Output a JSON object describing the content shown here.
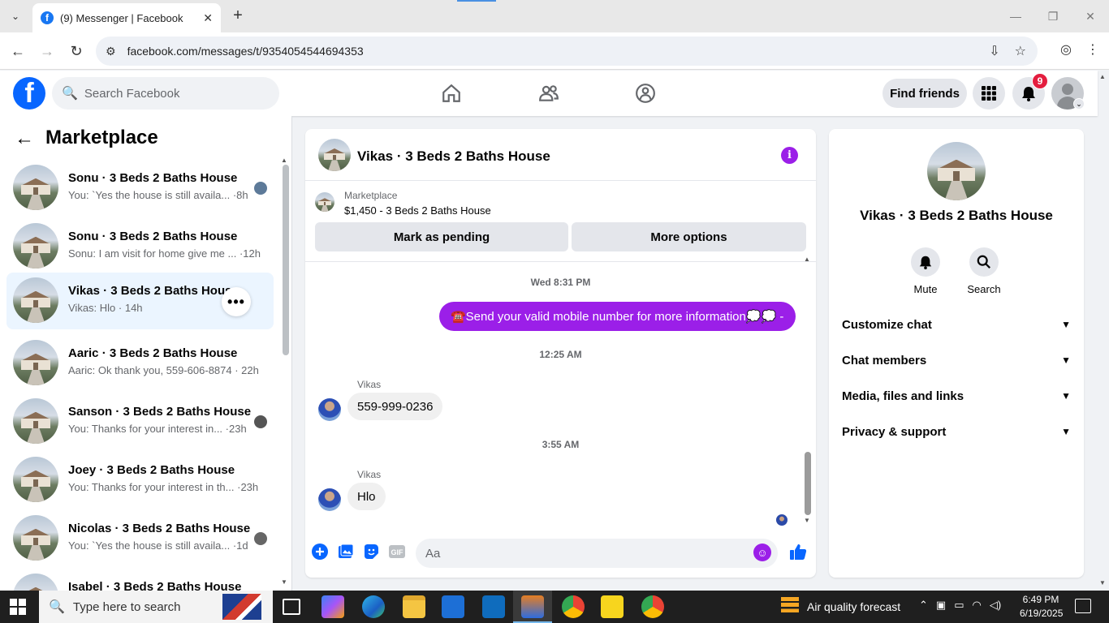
{
  "browser": {
    "tab_title": "(9) Messenger | Facebook",
    "tab_close": "✕",
    "new_tab": "+",
    "url": "facebook.com/messages/t/9354054544694353",
    "window_controls": [
      "—",
      "❐",
      "✕"
    ]
  },
  "fb_header": {
    "logo_letter": "f",
    "search_placeholder": "Search Facebook",
    "find_friends": "Find friends",
    "notification_count": "9"
  },
  "left_panel": {
    "back_icon": "←",
    "title": "Marketplace",
    "conversations": [
      {
        "name": "Sonu · 3 Beds 2 Baths House",
        "preview": "You: `Yes the house is still availa... ·8h"
      },
      {
        "name": "Sonu · 3 Beds 2 Baths House",
        "preview": "Sonu: I am visit for home give me ... ·12h"
      },
      {
        "name": "Vikas · 3 Beds 2 Baths House",
        "preview": "Vikas: Hlo · 14h",
        "more": "•••"
      },
      {
        "name": "Aaric · 3 Beds 2 Baths House",
        "preview": "Aaric: Ok thank you, 559-606-8874 · 22h"
      },
      {
        "name": "Sanson · 3 Beds 2 Baths House",
        "preview": "You: Thanks for your interest in... ·23h"
      },
      {
        "name": "Joey · 3 Beds 2 Baths House",
        "preview": "You: Thanks for your interest in th... ·23h"
      },
      {
        "name": "Nicolas · 3 Beds 2 Baths House",
        "preview": "You: `Yes the house is still availa... ·1d"
      },
      {
        "name": "Isabel · 3 Beds 2 Baths House",
        "preview": ""
      }
    ]
  },
  "chat": {
    "title": "Vikas · 3 Beds 2 Baths House",
    "info_icon": "i",
    "marketplace_label": "Marketplace",
    "listing": "$1,450 - 3 Beds 2 Baths House",
    "mark_pending": "Mark as pending",
    "more_options": "More options",
    "messages": {
      "ts1": "Wed 8:31 PM",
      "outgoing": "☎️Send your valid mobile number for more information💭💭 -",
      "ts2": "12:25 AM",
      "sender1": "Vikas",
      "incoming1": "559-999-0236",
      "ts3": "3:55 AM",
      "sender2": "Vikas",
      "incoming2": "Hlo"
    },
    "composer_placeholder": "Aa",
    "gif_label": "GIF"
  },
  "right_panel": {
    "name": "Vikas · 3 Beds 2 Baths House",
    "mute": "Mute",
    "search": "Search",
    "sections": [
      "Customize chat",
      "Chat members",
      "Media, files and links",
      "Privacy & support"
    ],
    "chevron": "⌄"
  },
  "taskbar": {
    "search_text": "Type here to search",
    "weather": "Air quality forecast",
    "time": "6:49 PM",
    "date": "6/19/2025"
  },
  "colors": {
    "fb_blue": "#0866ff",
    "accent_purple": "#9b1fe8",
    "badge_red": "#e41e3f"
  }
}
